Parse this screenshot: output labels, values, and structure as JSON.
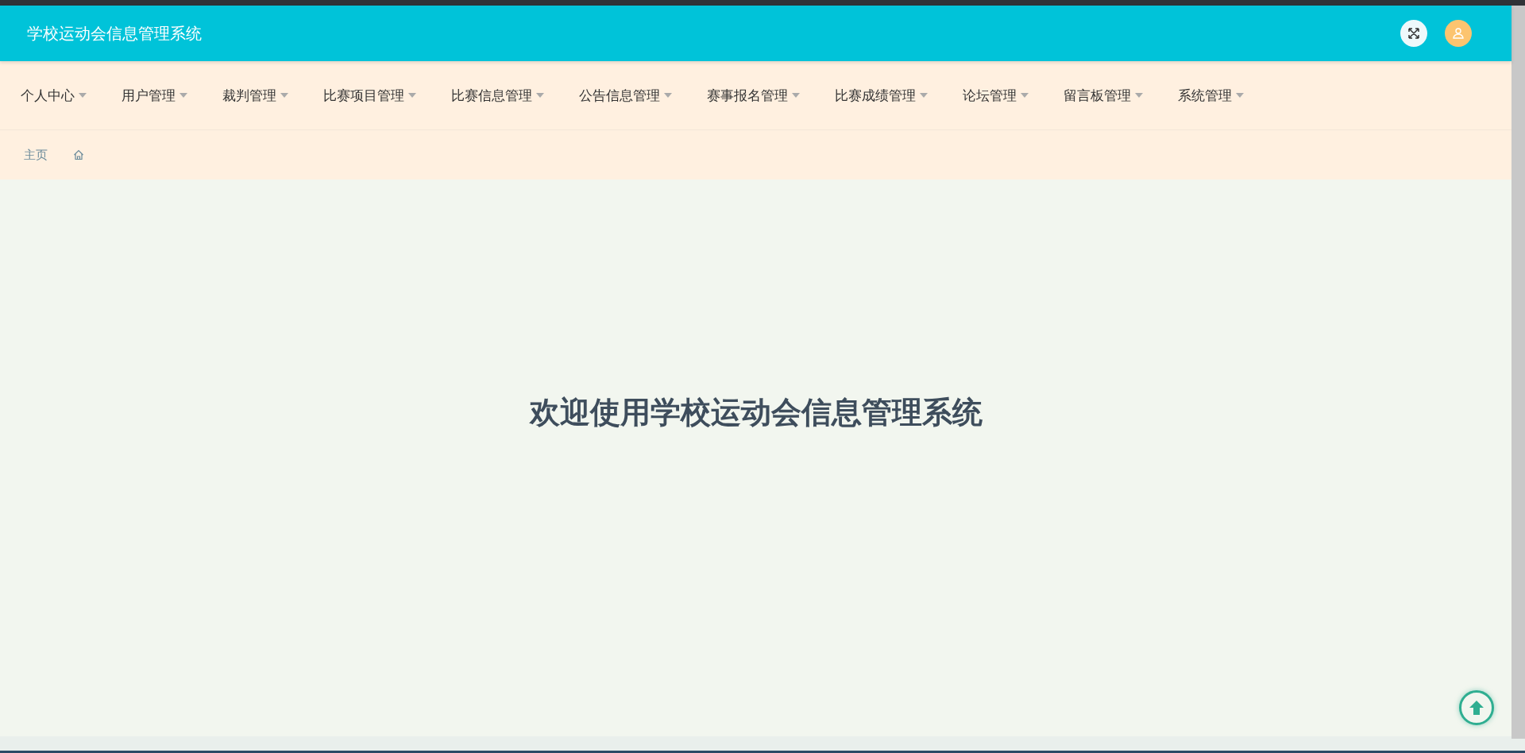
{
  "header": {
    "title": "学校运动会信息管理系统"
  },
  "nav": {
    "items": [
      {
        "label": "个人中心"
      },
      {
        "label": "用户管理"
      },
      {
        "label": "裁判管理"
      },
      {
        "label": "比赛项目管理"
      },
      {
        "label": "比赛信息管理"
      },
      {
        "label": "公告信息管理"
      },
      {
        "label": "赛事报名管理"
      },
      {
        "label": "比赛成绩管理"
      },
      {
        "label": "论坛管理"
      },
      {
        "label": "留言板管理"
      },
      {
        "label": "系统管理"
      }
    ]
  },
  "breadcrumb": {
    "items": [
      "主页"
    ]
  },
  "main": {
    "welcome": "欢迎使用学校运动会信息管理系统"
  }
}
